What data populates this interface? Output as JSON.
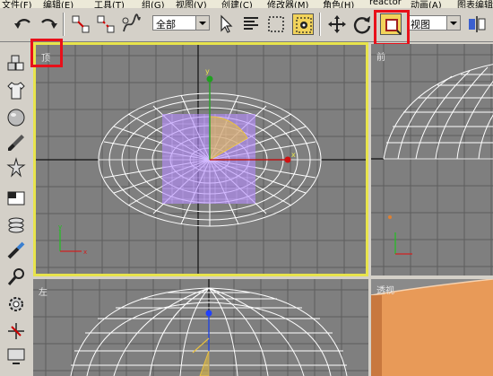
{
  "menu": [
    "文件(F)",
    "编辑(E)",
    "工具(T)",
    "组(G)",
    "视图(V)",
    "创建(C)",
    "修改器(M)",
    "角色(H)",
    "reactor",
    "动画(A)",
    "图表编辑"
  ],
  "toolbar": {
    "selection_filter": "全部",
    "reference_coord": "视图",
    "icons": [
      "undo-icon",
      "redo-icon",
      "link-icon",
      "unlink-icon",
      "bind-spacewarp-icon",
      "select-icon",
      "select-by-name-icon",
      "rect-region-icon",
      "window-crossing-icon",
      "move-icon",
      "rotate-icon",
      "named-selection-icon",
      "mirror-icon"
    ]
  },
  "sidebar": {
    "icons": [
      "create-geometry-icon",
      "shirt-icon",
      "sphere-shape-icon",
      "brush-icon",
      "star-icon",
      "modify-panel-icon",
      "stack-icon",
      "wrench-tool-icon",
      "hammer-icon",
      "gear-icon",
      "motion-icon",
      "display-icon"
    ]
  },
  "viewports": {
    "top": {
      "label": "顶",
      "axis_x": "x",
      "axis_y": "y"
    },
    "front": {
      "label": "前"
    },
    "left": {
      "label": "左"
    },
    "perspective": {
      "label": "透视"
    }
  },
  "colors": {
    "active_viewport_border": "#e8e44c",
    "highlight_box": "#e8101a",
    "viewport_bg": "#7f7f7f",
    "wireframe": "#ffffff",
    "selected_object": "#b58cff",
    "gizmo_yellow": "#e8c040"
  }
}
